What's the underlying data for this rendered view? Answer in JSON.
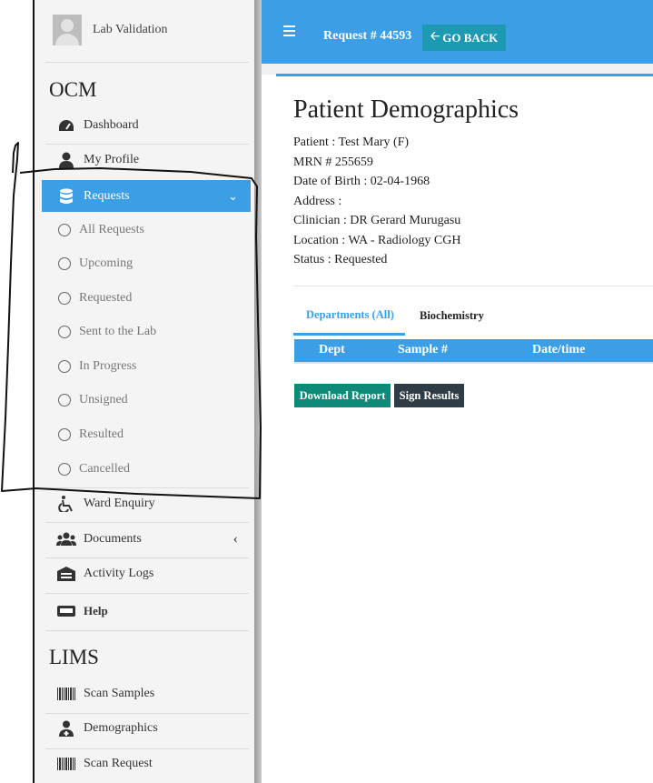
{
  "user": {
    "name": "Lab Validation"
  },
  "sidebar": {
    "ocm_header": "OCM",
    "lims_header": "LIMS",
    "items": [
      {
        "label": "Dashboard",
        "icon": "tachometer-icon"
      },
      {
        "label": "My Profile",
        "icon": "user-icon"
      },
      {
        "label": "Requests",
        "icon": "database-icon"
      },
      {
        "label": "Ward Enquiry",
        "icon": "wheelchair-icon"
      },
      {
        "label": "Documents",
        "icon": "users-icon"
      },
      {
        "label": "Activity Logs",
        "icon": "archive-icon"
      },
      {
        "label": "Help",
        "icon": "keyboard-icon"
      }
    ],
    "requests_sub": [
      "All Requests",
      "Upcoming",
      "Requested",
      "Sent to the Lab",
      "In Progress",
      "Unsigned",
      "Resulted",
      "Cancelled"
    ],
    "lims_items": [
      {
        "label": "Scan Samples",
        "icon": "barcode-icon"
      },
      {
        "label": "Demographics",
        "icon": "user-md-icon"
      },
      {
        "label": "Scan Request",
        "icon": "barcode-icon"
      }
    ]
  },
  "header": {
    "request_label": "Request # 44593",
    "go_back": "GO BACK"
  },
  "main": {
    "title": "Patient Demographics",
    "patient": "Patient : Test Mary (F)",
    "mrn": "MRN # 255659",
    "dob": "Date of Birth : 02-04-1968",
    "address": "Address :",
    "clinician": "Clinician : DR Gerard Murugasu",
    "location": "Location : WA - Radiology CGH",
    "status": "Status : Requested",
    "tabs": [
      "Departments (All)",
      "Biochemistry"
    ],
    "columns": [
      "Dept",
      "Sample #",
      "Date/time"
    ],
    "download_label": "Download Report",
    "sign_label": "Sign Results"
  },
  "colors": {
    "accent": "#3c9ee5",
    "go_back": "#1d9ab2",
    "download": "#0f8a78",
    "sign": "#2f3b45"
  }
}
